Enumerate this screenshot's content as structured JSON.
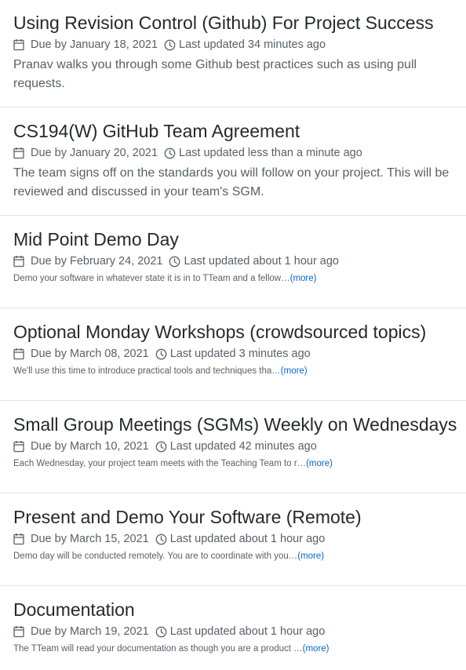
{
  "milestones": [
    {
      "title": "Using Revision Control (Github) For Project Success",
      "due": "Due by January 18, 2021",
      "updated": "Last updated 34 minutes ago",
      "description": "Pranav walks you through some Github best practices such as using pull requests."
    },
    {
      "title": "CS194(W) GitHub Team Agreement",
      "due": "Due by January 20, 2021",
      "updated": "Last updated less than a minute ago",
      "description": "The team signs off on the standards you will follow on your project. This will be reviewed and discussed in your team's SGM."
    },
    {
      "title": "Mid Point Demo Day",
      "due": "Due by February 24, 2021",
      "updated": "Last updated about 1 hour ago",
      "description": "Demo your software in whatever state it is in to TTeam and a fellow…",
      "more": "(more)"
    },
    {
      "title": "Optional Monday Workshops (crowdsourced topics)",
      "due": "Due by March 08, 2021",
      "updated": "Last updated 3 minutes ago",
      "description": "We'll use this time to introduce practical tools and techniques tha…",
      "more": "(more)"
    },
    {
      "title": "Small Group Meetings (SGMs) Weekly on Wednesdays",
      "due": "Due by March 10, 2021",
      "updated": "Last updated 42 minutes ago",
      "description": "Each Wednesday, your project team meets with the Teaching Team to r…",
      "more": "(more)"
    },
    {
      "title": "Present and Demo Your Software (Remote)",
      "due": "Due by March 15, 2021",
      "updated": "Last updated about 1 hour ago",
      "description": "Demo day will be conducted remotely. You are to coordinate with you…",
      "more": "(more)"
    },
    {
      "title": "Documentation",
      "due": "Due by March 19, 2021",
      "updated": "Last updated about 1 hour ago",
      "description": "The TTeam will read your documentation as though you are a product …",
      "more": "(more)"
    }
  ],
  "icons": {
    "due": "calendar-icon",
    "updated": "clock-icon"
  },
  "colors": {
    "title": "#24292e",
    "meta": "#586069",
    "link": "#0366d6",
    "divider": "#e1e4e8"
  }
}
